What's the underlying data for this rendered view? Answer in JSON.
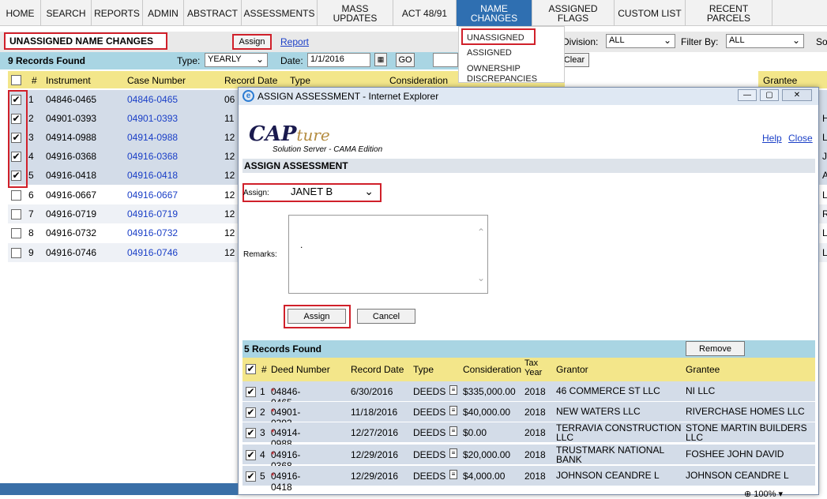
{
  "nav": {
    "items": [
      {
        "label": "HOME",
        "active": false
      },
      {
        "label": "SEARCH",
        "active": false
      },
      {
        "label": "REPORTS",
        "active": false
      },
      {
        "label": "ADMIN",
        "active": false
      },
      {
        "label": "ABSTRACT",
        "active": false
      },
      {
        "label": "ASSESSMENTS",
        "active": false
      },
      {
        "label": "MASS\nUPDATES",
        "active": false
      },
      {
        "label": "ACT 48/91",
        "active": false
      },
      {
        "label": "NAME\nCHANGES",
        "active": true
      },
      {
        "label": "ASSIGNED\nFLAGS",
        "active": false
      },
      {
        "label": "CUSTOM LIST",
        "active": false
      },
      {
        "label": "RECENT\nPARCELS",
        "active": false
      }
    ],
    "dropdown": [
      "UNASSIGNED",
      "ASSIGNED",
      "OWNERSHIP",
      "DISCREPANCIES"
    ]
  },
  "page": {
    "title": "UNASSIGNED NAME CHANGES",
    "assign_button": "Assign",
    "report_link": "Report",
    "division_label": "Division:",
    "division_value": "ALL",
    "filter_label": "Filter By:",
    "filter_value": "ALL",
    "sort_label": "So"
  },
  "filters": {
    "records_found": "9 Records Found",
    "type_label": "Type:",
    "type_value": "YEARLY",
    "date_label": "Date:",
    "date_value": "1/1/2016",
    "go_button": "GO",
    "clear_button": "Clear"
  },
  "table": {
    "columns": [
      "#",
      "Instrument",
      "Case Number",
      "Record Date",
      "Type",
      "Consideration",
      "Grantee"
    ],
    "rows": [
      {
        "n": "1",
        "instrument": "04846-0465",
        "case": "04846-0465",
        "date": "06",
        "checked": true,
        "right": ""
      },
      {
        "n": "2",
        "instrument": "04901-0393",
        "case": "04901-0393",
        "date": "11",
        "checked": true,
        "right": "H"
      },
      {
        "n": "3",
        "instrument": "04914-0988",
        "case": "04914-0988",
        "date": "12",
        "checked": true,
        "right": "L"
      },
      {
        "n": "4",
        "instrument": "04916-0368",
        "case": "04916-0368",
        "date": "12",
        "checked": true,
        "right": "J"
      },
      {
        "n": "5",
        "instrument": "04916-0418",
        "case": "04916-0418",
        "date": "12",
        "checked": true,
        "right": "A"
      },
      {
        "n": "6",
        "instrument": "04916-0667",
        "case": "04916-0667",
        "date": "12",
        "checked": false,
        "right": "L"
      },
      {
        "n": "7",
        "instrument": "04916-0719",
        "case": "04916-0719",
        "date": "12",
        "checked": false,
        "right": "R"
      },
      {
        "n": "8",
        "instrument": "04916-0732",
        "case": "04916-0732",
        "date": "12",
        "checked": false,
        "right": "L"
      },
      {
        "n": "9",
        "instrument": "04916-0746",
        "case": "04916-0746",
        "date": "12",
        "checked": false,
        "right": "L"
      }
    ]
  },
  "modal": {
    "window_title": "ASSIGN ASSESSMENT - Internet Explorer",
    "logo_cap": "CAP",
    "logo_ture": "ture",
    "logo_sub": "Solution Server - CAMA Edition",
    "help": "Help",
    "close": "Close",
    "section_title": "ASSIGN ASSESSMENT",
    "assign_label": "Assign:",
    "assign_value": "JANET B",
    "remarks_label": "Remarks:",
    "remarks_value": ".",
    "assign_button": "Assign",
    "cancel_button": "Cancel",
    "records_found": "5 Records Found",
    "remove_button": "Remove",
    "columns": [
      "#",
      "Deed Number",
      "Record Date",
      "Type",
      "Consideration",
      "Tax\nYear",
      "Grantor",
      "Grantee"
    ],
    "rows": [
      {
        "n": "1",
        "deed": "04846-0465",
        "date": "6/30/2016",
        "type": "DEEDS",
        "consideration": "$335,000.00",
        "year": "2018",
        "grantor": "46 COMMERCE ST LLC",
        "grantee": "NI LLC"
      },
      {
        "n": "2",
        "deed": "04901-0393",
        "date": "11/18/2016",
        "type": "DEEDS",
        "consideration": "$40,000.00",
        "year": "2018",
        "grantor": "NEW WATERS LLC",
        "grantee": "RIVERCHASE HOMES LLC"
      },
      {
        "n": "3",
        "deed": "04914-0988",
        "date": "12/27/2016",
        "type": "DEEDS",
        "consideration": "$0.00",
        "year": "2018",
        "grantor": "TERRAVIA CONSTRUCTION LLC",
        "grantee": "STONE MARTIN BUILDERS LLC"
      },
      {
        "n": "4",
        "deed": "04916-0368",
        "date": "12/29/2016",
        "type": "DEEDS",
        "consideration": "$20,000.00",
        "year": "2018",
        "grantor": "TRUSTMARK NATIONAL BANK",
        "grantee": "FOSHEE JOHN DAVID"
      },
      {
        "n": "5",
        "deed": "04916-0418",
        "date": "12/29/2016",
        "type": "DEEDS",
        "consideration": "$4,000.00",
        "year": "2018",
        "grantor": "JOHNSON CEANDRE L",
        "grantee": "JOHNSON CEANDRE L"
      }
    ],
    "zoom": "100%"
  },
  "colors": {
    "accent": "#2f6fb1",
    "highlight": "#d0202a",
    "table_header": "#f3e68a",
    "found_bar": "#a9d5e3"
  }
}
